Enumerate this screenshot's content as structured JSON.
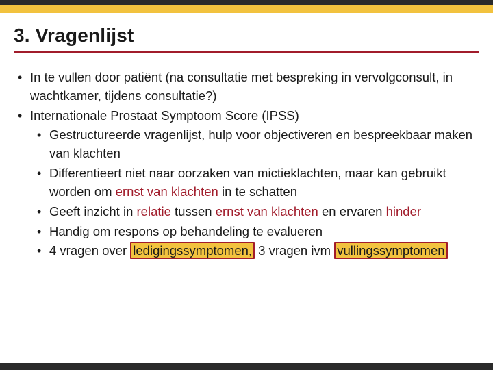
{
  "title": "3. Vragenlijst",
  "bullets": {
    "b1": "In te vullen door patiënt (na consultatie met bespreking in vervolgconsult, in wachtkamer, tijdens consultatie?)",
    "b2": "Internationale Prostaat Symptoom Score (IPSS)",
    "b2_1": "Gestructureerde vragenlijst, hulp voor objectiveren en bespreekbaar maken van klachten",
    "b2_2_a": "Differentieert niet naar oorzaken van mictieklachten, maar kan gebruikt worden om ",
    "b2_2_hl": "ernst van klachten",
    "b2_2_b": " in te schatten",
    "b2_3_a": "Geeft inzicht in ",
    "b2_3_hl1": "relatie",
    "b2_3_b": " tussen ",
    "b2_3_hl2": "ernst van klachten",
    "b2_3_c": " en ervaren ",
    "b2_3_hl3": "hinder",
    "b2_4": "Handig om respons op behandeling te evalueren",
    "b2_5_a": "4 vragen over ",
    "b2_5_box1": "ledigingssymptomen,",
    "b2_5_b": " 3 vragen ivm ",
    "b2_5_box2": "vullingssymptomen"
  },
  "colors": {
    "accent_red": "#a11c2b",
    "accent_gold": "#f2c23e",
    "bar_dark": "#2a2a2a"
  }
}
